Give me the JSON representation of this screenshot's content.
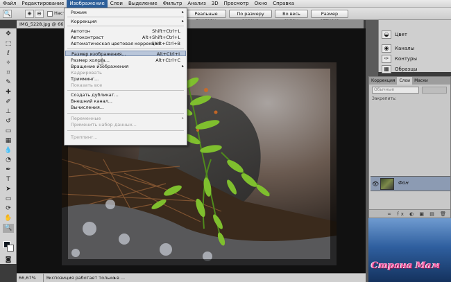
{
  "menubar": {
    "items": [
      "Файл",
      "Редактирование",
      "Изображение",
      "Слои",
      "Выделение",
      "Фильтр",
      "Анализ",
      "3D",
      "Просмотр",
      "Окно",
      "Справка"
    ]
  },
  "options": {
    "checkbox_label": "Настр",
    "btn_pixels": "Реальные пикселы",
    "btn_fit_screen": "По размеру экрана",
    "btn_full_screen": "Во весь экран",
    "btn_print": "Размер оттиска"
  },
  "document": {
    "tab_title": "IMG_5228.jpg @ 66",
    "zoom": "66,67%",
    "status_text": "Экспозиция работает только в ..."
  },
  "image_menu": {
    "mode": "Режим",
    "correction": "Коррекция",
    "auto_tone": "Автотон",
    "auto_tone_sc": "Shift+Ctrl+L",
    "auto_contrast": "Автоконтраст",
    "auto_contrast_sc": "Alt+Shift+Ctrl+L",
    "auto_color": "Автоматическая цветовая коррекция",
    "auto_color_sc": "Shift+Ctrl+B",
    "image_size": "Размер изображения...",
    "image_size_sc": "Alt+Ctrl+I",
    "canvas_size": "Размер холста...",
    "canvas_size_sc": "Alt+Ctrl+C",
    "rotate": "Вращение изображения",
    "crop": "Кадрировать",
    "trim": "Тримминг...",
    "reveal_all": "Показать все",
    "duplicate": "Создать дубликат...",
    "apply_image": "Внешний канал...",
    "calculations": "Вычисления...",
    "variables": "Переменные",
    "apply_data": "Применить набор данных...",
    "trapping": "Треппинг..."
  },
  "panels": {
    "color": "Цвет",
    "channels": "Каналы",
    "paths": "Контуры",
    "samples": "Образцы"
  },
  "layers_panel": {
    "tabs": [
      "Коррекция",
      "Слои",
      "Маски"
    ],
    "blend_mode": "Обычные",
    "lock_label": "Закрепить:",
    "layer_name": "Фон",
    "footer_icons": "∞ fx ◐ ▣ ▤ 🗑"
  },
  "watermark": "Страна Мам"
}
